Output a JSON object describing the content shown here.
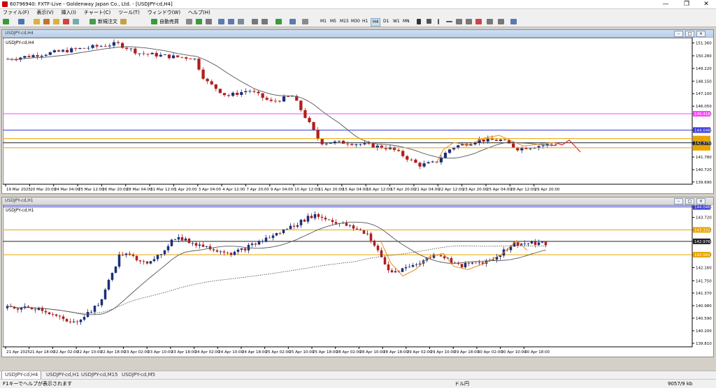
{
  "app": {
    "title": "60796940: FXTF-Live - Goldenway Japan Co., Ltd. - [USDJPY-cd,H4]"
  },
  "menu": [
    "ファイル(F)",
    "表示(V)",
    "挿入(I)",
    "チャート(C)",
    "ツール(T)",
    "ウィンドウ(W)",
    "ヘルプ(H)"
  ],
  "toolbar": {
    "new_order": "新規注文",
    "auto_trade": "自動売買",
    "timeframes": [
      "M1",
      "M5",
      "M15",
      "M30",
      "H1",
      "H4",
      "D1",
      "W1",
      "MN"
    ],
    "active_tf": "H4"
  },
  "colors": {
    "bull": "#1b2f7a",
    "bear": "#b01e1e",
    "ma": "#555555",
    "fit": "#e58a1f",
    "proj": "#e32020",
    "magenta": "#ff44ff",
    "blue": "#3a3ad8",
    "gold": "#e8a400"
  },
  "chart1": {
    "window_title": "USDJPY-cd,H4",
    "label": "USDJPY-cd,H4",
    "price_labels": [
      "151.360",
      "150.280",
      "149.220",
      "148.150",
      "147.100",
      "146.050",
      "145.416",
      "144.046",
      "142.976",
      "142.880",
      "141.780",
      "140.720",
      "139.690"
    ],
    "time_labels": [
      "19 Mar 2025",
      "20 Mar 20:00",
      "24 Mar 04:00",
      "25 Mar 12:00",
      "26 Mar 20:00",
      "28 Mar 04:00",
      "31 Mar 12:00",
      "1 Apr 20:00",
      "3 Apr 04:00",
      "4 Apr 12:00",
      "7 Apr 20:00",
      "9 Apr 04:00",
      "10 Apr 12:00",
      "11 Apr 20:00",
      "15 Apr 04:00",
      "16 Apr 12:00",
      "17 Apr 20:00",
      "21 Apr 04:00",
      "22 Apr 12:00",
      "23 Apr 20:00",
      "25 Apr 04:00",
      "28 Apr 12:00",
      "29 Apr 20:00"
    ],
    "hlines": {
      "magenta": "145.416",
      "blue": "144.046",
      "current": "142.976"
    },
    "ylim": [
      139.5,
      151.8
    ]
  },
  "chart2": {
    "window_title": "USDJPY-cd,H1",
    "label": "USDJPY-cd,H1",
    "price_labels": [
      "144.046",
      "143.720",
      "143.332",
      "142.976",
      "142.562",
      "142.160",
      "141.750",
      "141.370",
      "140.980",
      "140.590",
      "140.200",
      "139.810"
    ],
    "time_labels": [
      "21 Apr 2025",
      "21 Apr 18:00",
      "22 Apr 02:00",
      "22 Apr 10:00",
      "22 Apr 18:00",
      "23 Apr 02:00",
      "23 Apr 10:00",
      "23 Apr 18:00",
      "24 Apr 02:00",
      "24 Apr 10:00",
      "24 Apr 18:00",
      "25 Apr 02:00",
      "25 Apr 10:00",
      "25 Apr 18:00",
      "28 Apr 02:00",
      "28 Apr 10:00",
      "28 Apr 18:00",
      "29 Apr 02:00",
      "29 Apr 10:00",
      "29 Apr 18:00",
      "30 Apr 02:00",
      "30 Apr 10:00",
      "30 Apr 18:00"
    ],
    "hlines": {
      "blue": "144.046",
      "gold_top": "143.332",
      "current": "142.976",
      "gold_bottom": "142.562"
    },
    "ylim": [
      139.7,
      144.1
    ]
  },
  "tabs": [
    "USDJPY-cd,H4",
    "USDJPY-cd,H1",
    "USDJPY-cd,M15",
    "USDJPY-cd,M5"
  ],
  "active_tab": "USDJPY-cd,H4",
  "status": {
    "help": "F1キーでヘルプが表示されます",
    "symbol": "ドル円",
    "traffic": "9057/9 kb"
  }
}
